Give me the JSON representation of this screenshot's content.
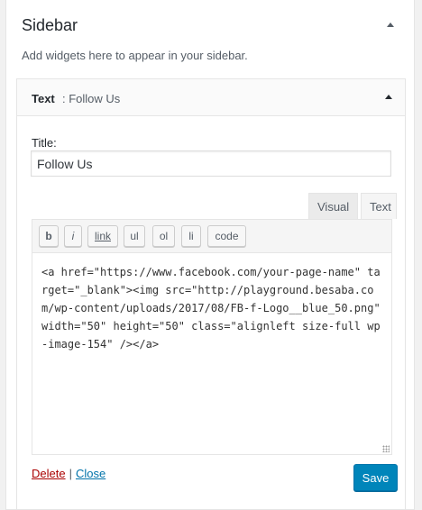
{
  "sidebar": {
    "title": "Sidebar",
    "description": "Add widgets here to appear in your sidebar."
  },
  "widget": {
    "title_strong": "Text",
    "title_in": ": Follow Us",
    "title_label": "Title:",
    "title_value": "Follow Us",
    "tabs": {
      "visual": "Visual",
      "text": "Text"
    },
    "toolbar": {
      "b": "b",
      "i": "i",
      "link": "link",
      "ul": "ul",
      "ol": "ol",
      "li": "li",
      "code": "code"
    },
    "content": "<a href=\"https://www.facebook.com/your-page-name\" target=\"_blank\"><img src=\"http://playground.besaba.com/wp-content/uploads/2017/08/FB-f-Logo__blue_50.png\" width=\"50\" height=\"50\" class=\"alignleft size-full wp-image-154\" /></a>",
    "delete_label": "Delete",
    "separator": "|",
    "close_label": "Close",
    "save_label": "Save"
  }
}
